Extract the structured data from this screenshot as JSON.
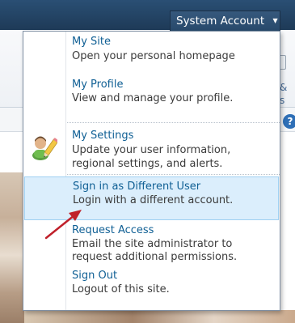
{
  "topbar": {
    "account_label": "System Account",
    "help_label": "?",
    "right_text": "&\ns"
  },
  "menu": {
    "items": [
      {
        "title": "My Site",
        "desc": [
          "Open your personal homepage"
        ]
      },
      {
        "title": "My Profile",
        "desc": [
          "View and manage your profile."
        ]
      },
      {
        "title": "My Settings",
        "desc": [
          "Update your user information,",
          "regional settings, and alerts."
        ]
      },
      {
        "title": "Sign in as Different User",
        "desc": [
          "Login with a different account."
        ]
      },
      {
        "title": "Request Access",
        "desc": [
          "Email the site administrator to",
          "request additional permissions."
        ]
      },
      {
        "title": "Sign Out",
        "desc": [
          "Logout of this site."
        ]
      }
    ],
    "highlighted_index": 3
  },
  "colors": {
    "link": "#0f5f94",
    "highlight_bg": "#dbeefc",
    "highlight_border": "#9fd0f2",
    "arrow": "#c0202a"
  },
  "icons": {
    "settings": "user-pencil-icon",
    "dropdown": "chevron-down-icon",
    "help": "help-icon"
  }
}
